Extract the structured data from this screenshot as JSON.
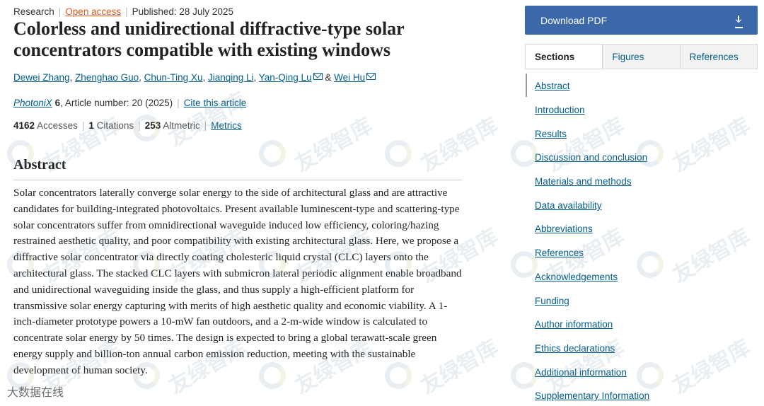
{
  "meta": {
    "article_type": "Research",
    "access": "Open access",
    "published": "Published: 28 July 2025"
  },
  "title": "Colorless and unidirectional diffractive-type solar concentrators compatible with existing windows",
  "authors": {
    "list": [
      "Dewei Zhang",
      "Zhenghao Guo",
      "Chun-Ting Xu",
      "Jianqing Li",
      "Yan-Qing Lu",
      "Wei Hu"
    ],
    "and_sep": "&"
  },
  "journal": {
    "name": "PhotoniX",
    "volume": "6",
    "article_info": ", Article number: 20 (2025)",
    "cite": "Cite this article"
  },
  "metrics": {
    "accesses_value": "4162",
    "accesses_label": "Accesses",
    "citations_value": "1",
    "citations_label": "Citations",
    "altmetric_value": "253",
    "altmetric_label": "Altmetric",
    "metrics_link": "Metrics"
  },
  "abstract": {
    "heading": "Abstract",
    "text": "Solar concentrators laterally converge solar energy to the side of architectural glass and are attractive candidates for building-integrated photovoltaics. Present available luminescent-type and scattering-type solar concentrators suffer from omnidirectional waveguide induced low efficiency, coloring/hazing restrained aesthetic quality, and poor compatibility with existing architectural glass. Here, we propose a diffractive solar concentrator via directly coating cholesteric liquid crystal (CLC) layers onto the architectural glass. The stacked CLC layers with submicron lateral periodic alignment enable broadband and unidirectional waveguiding inside the glass, and thus supply a high-efficient platform for transmissive solar energy capturing with merits of high aesthetic quality and economic viability. A 1-inch-diameter prototype powers a 10-mW fan outdoors, and a 2-m-wide window is calculated to concentrate solar energy by 50 times. The design is expected to bring a global terawatt-scale green energy supply and billion-ton annual carbon emission reduction, meeting with the sustainable development of human society."
  },
  "sidebar": {
    "download_label": "Download PDF",
    "download_icon": "download-icon",
    "tabs": [
      "Sections",
      "Figures",
      "References"
    ],
    "active_tab": "Sections",
    "toc": [
      "Abstract",
      "Introduction",
      "Results",
      "Discussion and conclusion",
      "Materials and methods",
      "Data availability",
      "Abbreviations",
      "References",
      "Acknowledgements",
      "Funding",
      "Author information",
      "Ethics declarations",
      "Additional information",
      "Supplementary Information"
    ]
  },
  "watermark": {
    "text": "友绿智库",
    "bottom_text": "大数据在线"
  },
  "colors": {
    "link": "#025e8d",
    "open_access": "#e05a1e",
    "pdf_button": "#3a68a8"
  }
}
